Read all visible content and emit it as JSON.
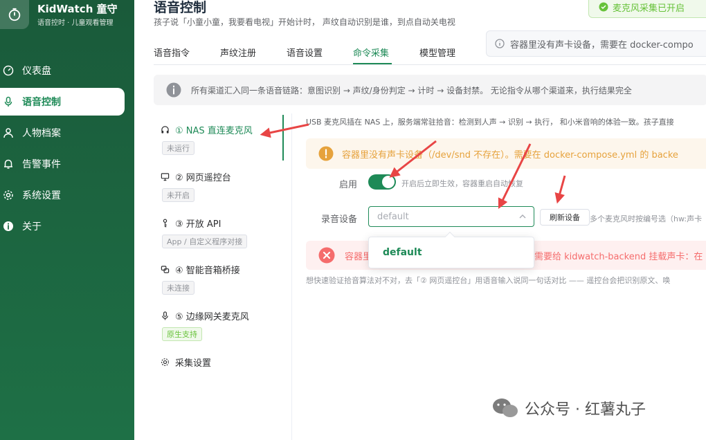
{
  "app": {
    "title": "KidWatch 童守",
    "subtitle": "语音控时 · 儿童观看管理"
  },
  "sidebar": {
    "items": [
      {
        "label": "仪表盘",
        "icon": "gauge-icon"
      },
      {
        "label": "语音控制",
        "icon": "microphone-icon",
        "active": true
      },
      {
        "label": "人物档案",
        "icon": "user-icon"
      },
      {
        "label": "告警事件",
        "icon": "bell-icon"
      },
      {
        "label": "系统设置",
        "icon": "gear-icon"
      },
      {
        "label": "关于",
        "icon": "info-icon"
      }
    ]
  },
  "header": {
    "title": "语音控制",
    "desc": "孩子说「小童小童，我要看电视」开始计时， 声纹自动识别是谁，到点自动关电视",
    "status": "麦克风采集已开启",
    "warning": "容器里没有声卡设备，需要在 docker-compo"
  },
  "tabs": [
    "语音指令",
    "声纹注册",
    "语音设置",
    "命令采集",
    "模型管理"
  ],
  "info_bar": "所有渠道汇入同一条语音链路：意图识别 → 声纹/身份判定 → 计时 → 设备封禁。 无论指令从哪个渠道来，执行结果完全",
  "channels": [
    {
      "title": "① NAS 直连麦克风",
      "tag": "未运行",
      "icon": "headphones-icon",
      "active": true
    },
    {
      "title": "② 网页遥控台",
      "tag": "未开启",
      "icon": "monitor-icon"
    },
    {
      "title": "③ 开放 API",
      "tag": "App / 自定义程序对接",
      "icon": "key-icon"
    },
    {
      "title": "④ 智能音箱桥接",
      "tag": "未连接",
      "icon": "link-icon"
    },
    {
      "title": "⑤ 边缘网关麦克风",
      "tag": "原生支持",
      "icon": "mic-small-icon",
      "tag_green": true
    },
    {
      "title": "采集设置",
      "icon": "gear-icon"
    }
  ],
  "detail": {
    "desc": "USB 麦克风插在 NAS 上，服务端常驻拾音：检测到人声 → 识别 → 执行， 和小米音响的体验一致。孩子直接",
    "warn_alert": "容器里没有声卡设备（/dev/snd 不存在）。需要在 docker-compose.yml 的 backe",
    "enable_label": "启用",
    "enable_on": true,
    "enable_hint": "开启后立即生效，容器重启自动恢复",
    "device_label": "录音设备",
    "device_placeholder": "default",
    "refresh_label": "刷新设备",
    "refresh_hint": "多个麦克风时按编号选（hw:声卡",
    "err_prefix": "容器里",
    "err_text": "需要给 kidwatch-backend 挂载声卡：在",
    "dropdown_option": "default",
    "bottom_hint": "想快速验证拾音算法对不对，去「② 网页遥控台」用语音输入说同一句话对比 —— 遥控台会把识别原文、唤"
  },
  "watermark": "公众号 · 红薯丸子",
  "colors": {
    "primary": "#1e8a57",
    "sidebar": "#1a5a3a",
    "warning": "#e6a23c",
    "error": "#f56c6c",
    "annotation": "#e84545"
  }
}
